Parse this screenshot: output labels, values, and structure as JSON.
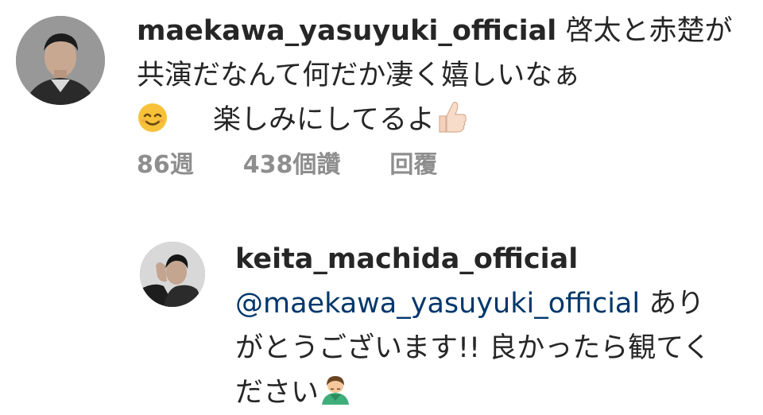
{
  "comment": {
    "username": "maekawa_yasuyuki_official",
    "text_line_1": " 啓太と赤楚が共演だなんて何だか凄く嬉しいなぁ",
    "emoji_smile": "smiling-face-icon",
    "text_line_2": "楽しみにしてるよ",
    "emoji_thumb": "thumbs-up-icon",
    "time": "86週",
    "likes": "438個讚",
    "reply": "回覆"
  },
  "reply": {
    "username": "keita_machida_official",
    "mention": "@maekawa_yasuyuki_official",
    "text": " ありがとうございます!! 良かったら観てください",
    "emoji_bow": "person-bowing-icon"
  },
  "colors": {
    "text": "#262626",
    "meta": "#8e8e8e",
    "mention": "#00376b"
  }
}
